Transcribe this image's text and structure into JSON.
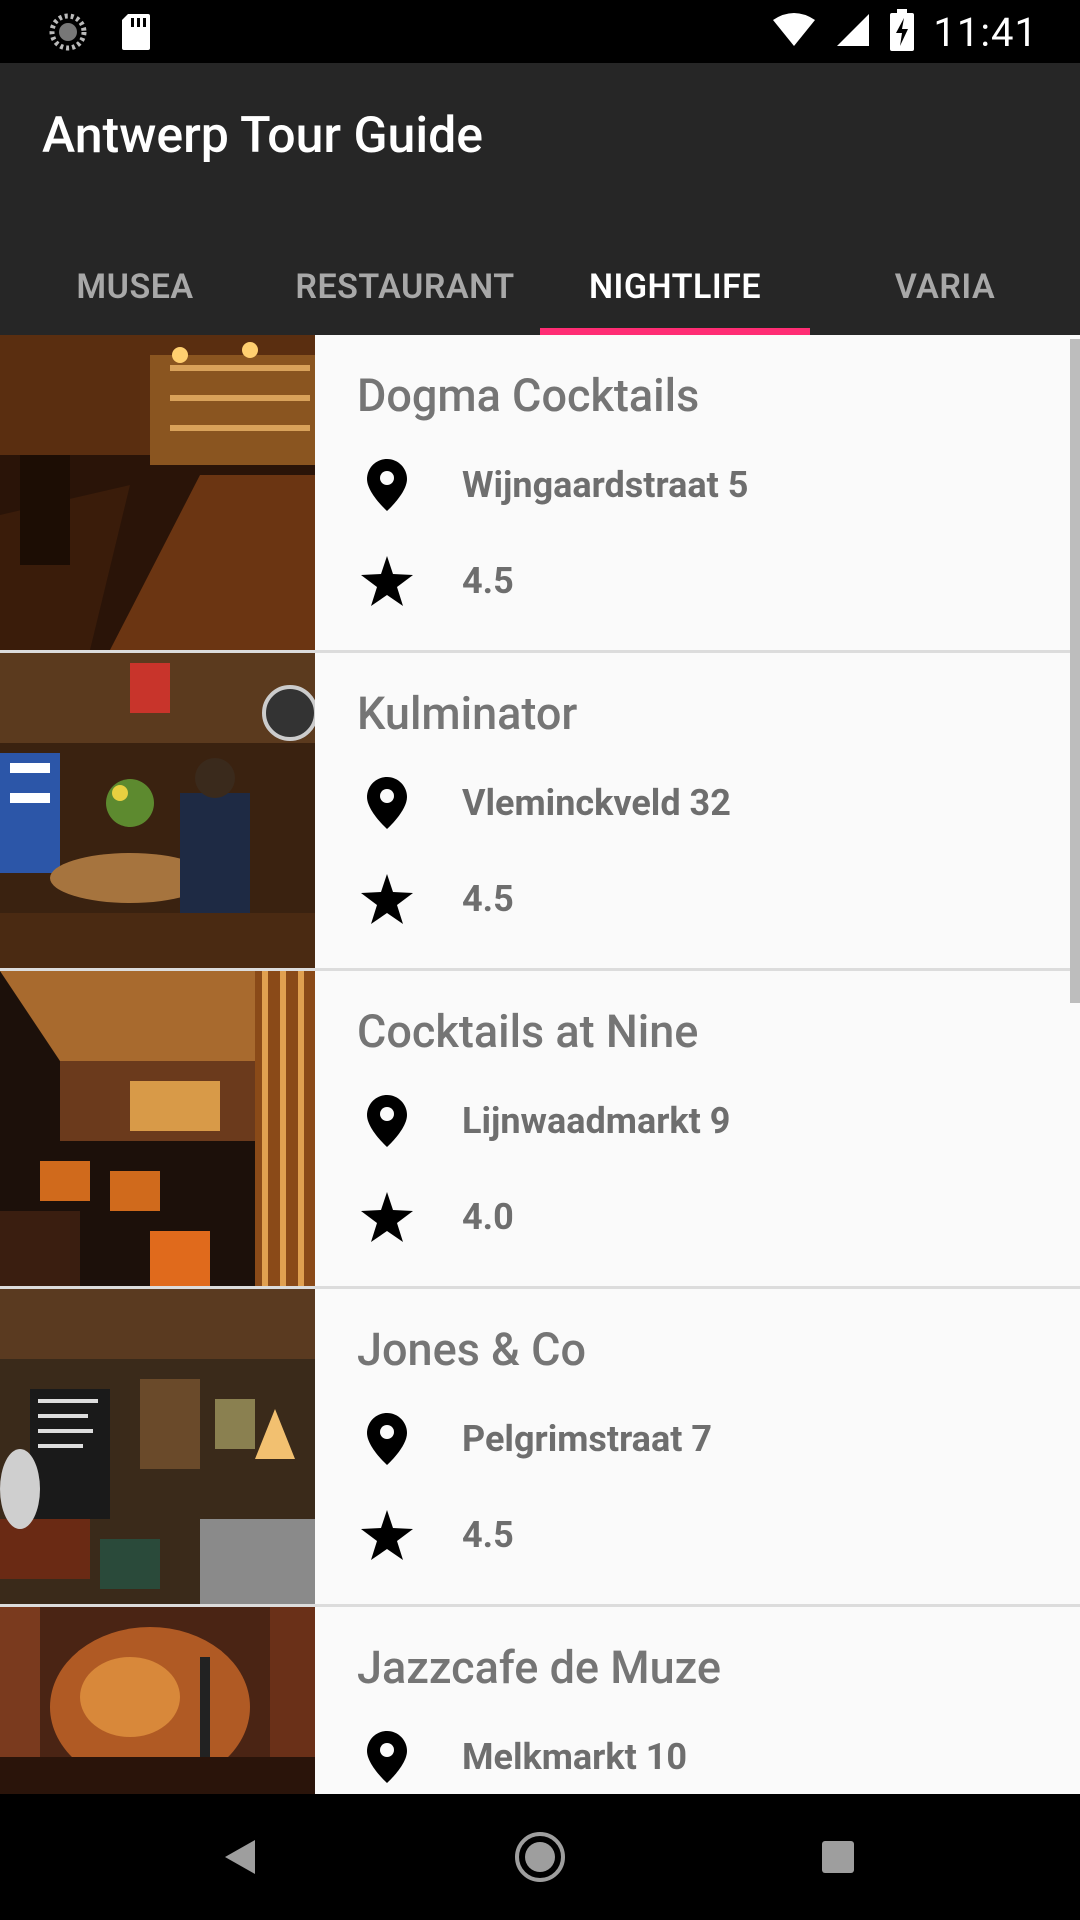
{
  "status": {
    "time": "11:41"
  },
  "app": {
    "title": "Antwerp Tour Guide"
  },
  "tabs": [
    {
      "label": "MUSEA",
      "active": false
    },
    {
      "label": "RESTAURANT",
      "active": false
    },
    {
      "label": "NIGHTLIFE",
      "active": true
    },
    {
      "label": "VARIA",
      "active": false
    }
  ],
  "colors": {
    "accent": "#ff2d74",
    "appbar": "#262626",
    "text_secondary": "#757575"
  },
  "items": [
    {
      "name": "Dogma Cocktails",
      "address": "Wijngaardstraat 5",
      "rating": "4.5"
    },
    {
      "name": "Kulminator",
      "address": "Vleminckveld 32",
      "rating": "4.5"
    },
    {
      "name": "Cocktails at Nine",
      "address": "Lijnwaadmarkt 9",
      "rating": "4.0"
    },
    {
      "name": "Jones & Co",
      "address": "Pelgrimstraat 7",
      "rating": "4.5"
    },
    {
      "name": "Jazzcafe de Muze",
      "address": "Melkmarkt 10",
      "rating": ""
    }
  ],
  "icons": {
    "address": "location-pin-icon",
    "rating": "star-icon"
  }
}
